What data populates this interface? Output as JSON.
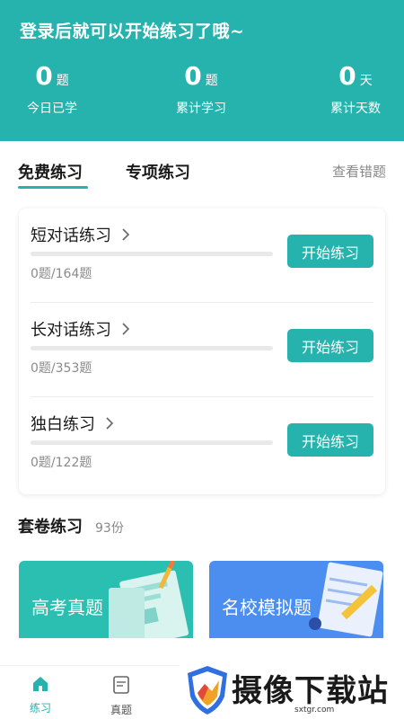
{
  "header": {
    "login_tip": "登录后就可以开始练习了哦~",
    "stats": [
      {
        "num": "0",
        "unit": "题",
        "label": "今日已学"
      },
      {
        "num": "0",
        "unit": "题",
        "label": "累计学习"
      },
      {
        "num": "0",
        "unit": "天",
        "label": "累计天数"
      }
    ]
  },
  "tabs": {
    "free": "免费练习",
    "special": "专项练习",
    "review": "查看错题"
  },
  "practice_items": [
    {
      "title": "短对话练习",
      "count": "0题/164题",
      "progress": 0,
      "button": "开始练习"
    },
    {
      "title": "长对话练习",
      "count": "0题/353题",
      "progress": 0,
      "button": "开始练习"
    },
    {
      "title": "独白练习",
      "count": "0题/122题",
      "progress": 0,
      "button": "开始练习"
    }
  ],
  "paper": {
    "title": "套卷练习",
    "count": "93份",
    "banners": [
      {
        "label": "高考真题",
        "color": "#2bbfb2"
      },
      {
        "label": "名校模拟题",
        "color": "#4b8ef0"
      }
    ]
  },
  "nav": {
    "practice": "练习",
    "real": "真题"
  },
  "watermark": {
    "brand": "摄像下载站",
    "site": "sxtgr.com"
  },
  "colors": {
    "accent": "#26b3ad",
    "muted": "#888888"
  }
}
